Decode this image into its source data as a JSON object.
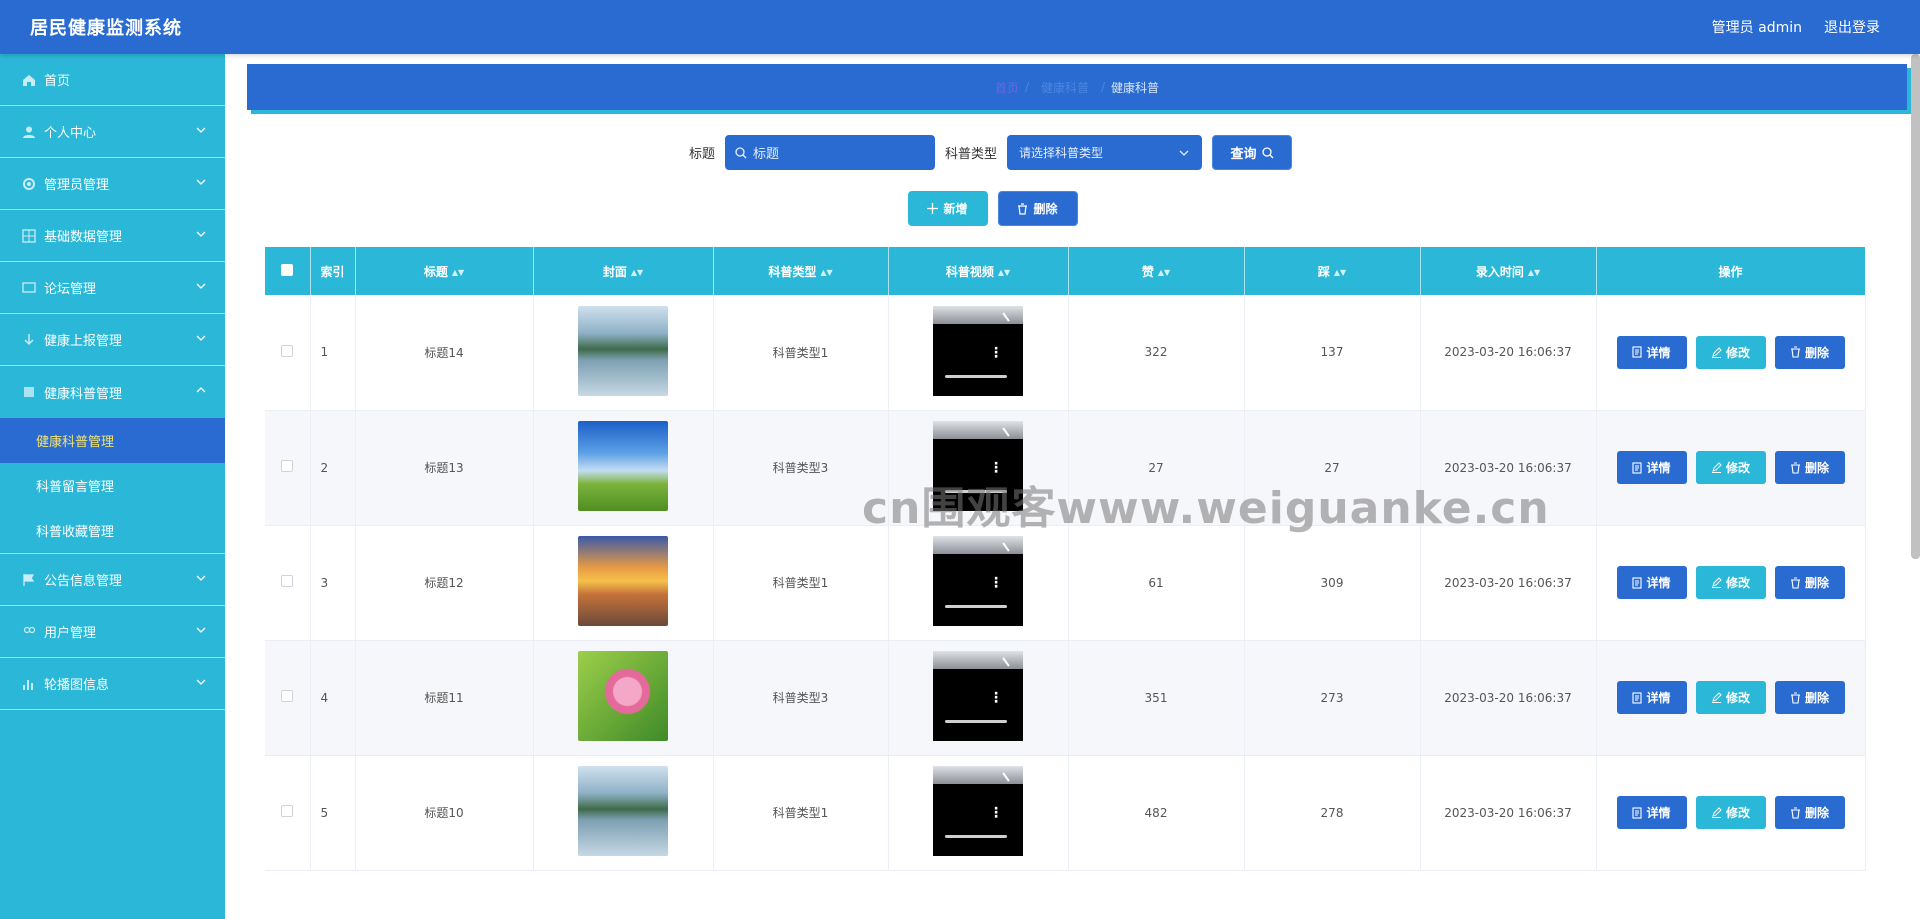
{
  "header": {
    "title": "居民健康监测系统",
    "admin_label": "管理员 admin",
    "logout_label": "退出登录"
  },
  "sidebar": {
    "items": [
      {
        "label": "首页",
        "icon": "home-icon"
      },
      {
        "label": "个人中心",
        "icon": "user-icon"
      },
      {
        "label": "管理员管理",
        "icon": "gear-icon"
      },
      {
        "label": "基础数据管理",
        "icon": "grid-icon"
      },
      {
        "label": "论坛管理",
        "icon": "forum-icon"
      },
      {
        "label": "健康上报管理",
        "icon": "report-icon"
      },
      {
        "label": "健康科普管理",
        "icon": "book-icon"
      },
      {
        "label": "公告信息管理",
        "icon": "flag-icon"
      },
      {
        "label": "用户管理",
        "icon": "users-icon"
      },
      {
        "label": "轮播图信息",
        "icon": "chart-icon"
      }
    ],
    "subitems": [
      {
        "label": "健康科普管理"
      },
      {
        "label": "科普留言管理"
      },
      {
        "label": "科普收藏管理"
      }
    ]
  },
  "breadcrumb": {
    "home": "首页",
    "middle": "健康科普",
    "current": "健康科普"
  },
  "search": {
    "title_label": "标题",
    "title_placeholder": "标题",
    "type_label": "科普类型",
    "type_placeholder": "请选择科普类型",
    "query_label": "查询"
  },
  "actions": {
    "add_label": "新增",
    "delete_label": "删除"
  },
  "table": {
    "columns": [
      "索引",
      "标题",
      "封面",
      "科普类型",
      "科普视频",
      "赞",
      "踩",
      "录入时间",
      "操作"
    ],
    "rows": [
      {
        "index": "1",
        "title": "标题14",
        "type": "科普类型1",
        "likes": "322",
        "dislikes": "137",
        "time": "2023-03-20 16:06:37",
        "cover": "landscape-lake"
      },
      {
        "index": "2",
        "title": "标题13",
        "type": "科普类型3",
        "likes": "27",
        "dislikes": "27",
        "time": "2023-03-20 16:06:37",
        "cover": "grass-sky"
      },
      {
        "index": "3",
        "title": "标题12",
        "type": "科普类型1",
        "likes": "61",
        "dislikes": "309",
        "time": "2023-03-20 16:06:37",
        "cover": "sunset-beach"
      },
      {
        "index": "4",
        "title": "标题11",
        "type": "科普类型3",
        "likes": "351",
        "dislikes": "273",
        "time": "2023-03-20 16:06:37",
        "cover": "lotus"
      },
      {
        "index": "5",
        "title": "标题10",
        "type": "科普类型1",
        "likes": "482",
        "dislikes": "278",
        "time": "2023-03-20 16:06:37",
        "cover": "landscape-lake"
      }
    ],
    "op_labels": {
      "detail": "详情",
      "edit": "修改",
      "delete": "删除"
    }
  },
  "watermark": "cn围观客www.weiguanke.cn",
  "colors": {
    "primary": "#2a6bd1",
    "accent": "#2bb8d8",
    "active_text": "#f4e36b"
  }
}
